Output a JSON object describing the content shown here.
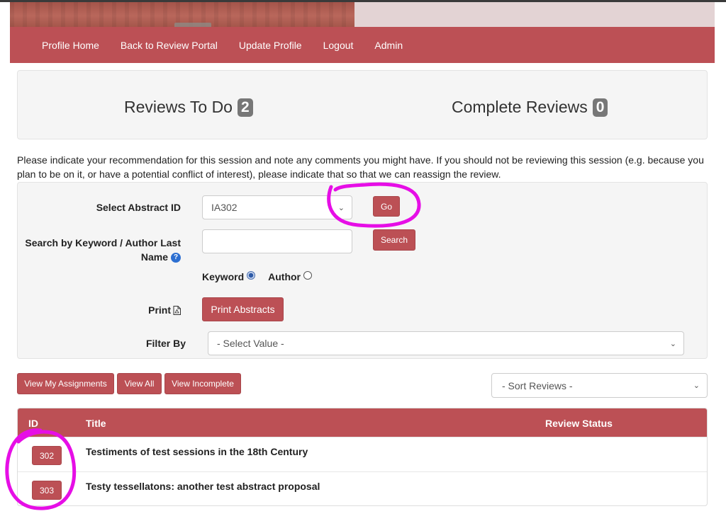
{
  "nav": {
    "items": [
      "Profile Home",
      "Back to Review Portal",
      "Update Profile",
      "Logout",
      "Admin"
    ]
  },
  "stats": {
    "todo_label": "Reviews To Do",
    "todo_count": "2",
    "complete_label": "Complete Reviews",
    "complete_count": "0"
  },
  "instructions": "Please indicate your recommendation for this session and note any comments you might have. If you should not be reviewing this session (e.g. because you plan to be on it, or have a potential conflict of interest), please indicate that so that we can reassign the review.",
  "form": {
    "abstract_label": "Select Abstract ID",
    "abstract_value": "IA302",
    "go_label": "Go",
    "search_label": "Search by Keyword / Author Last Name",
    "search_value": "",
    "search_button": "Search",
    "radio_keyword": "Keyword",
    "radio_author": "Author",
    "print_label": "Print",
    "print_button": "Print Abstracts",
    "filter_label": "Filter By",
    "filter_value": "- Select Value -"
  },
  "actions": {
    "view_assignments": "View My Assignments",
    "view_all": "View All",
    "view_incomplete": "View Incomplete",
    "sort_value": "- Sort Reviews -"
  },
  "table": {
    "headers": {
      "id": "ID",
      "title": "Title",
      "status": "Review Status"
    },
    "rows": [
      {
        "id": "302",
        "title": "Testiments of test sessions in the 18th Century",
        "status": ""
      },
      {
        "id": "303",
        "title": "Testy tessellatons: another test abstract proposal",
        "status": ""
      }
    ]
  },
  "colors": {
    "brand": "#bc5055",
    "badge": "#777777",
    "annotation": "#e60ee6"
  }
}
